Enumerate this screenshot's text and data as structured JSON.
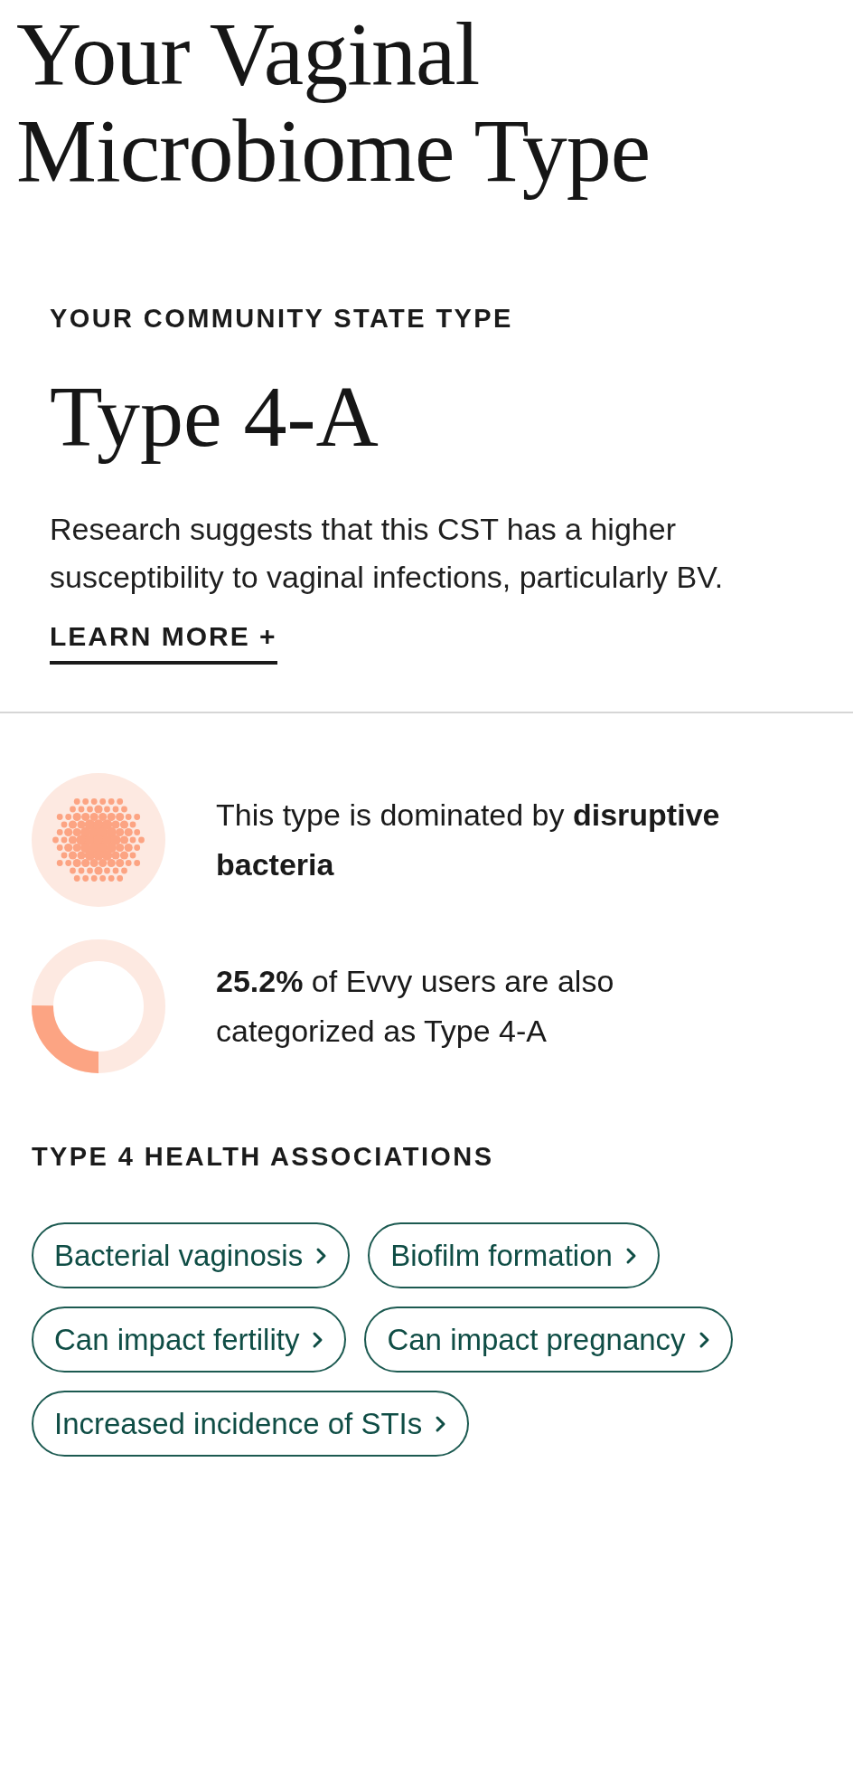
{
  "title": "Your Vaginal Microbiome Type",
  "cst": {
    "eyebrow": "YOUR COMMUNITY STATE TYPE",
    "type": "Type 4-A",
    "description": "Research suggests that this CST has a higher susceptibility to vaginal infections, particularly BV.",
    "link": "LEARN MORE +"
  },
  "facts": [
    {
      "kind": "bacteria",
      "text": "This type is dominated by **disruptive bacteria**"
    },
    {
      "kind": "donut",
      "level": 0.252,
      "text": "**25.2%** of Evvy users are also categorized as Type 4-A"
    }
  ],
  "associations": {
    "heading": "TYPE 4 HEALTH ASSOCIATIONS",
    "chips": [
      "Bacterial vaginosis",
      "Biofilm formation",
      "Can impact fertility",
      "Can impact pregnancy",
      "Increased incidence of STIs"
    ]
  }
}
